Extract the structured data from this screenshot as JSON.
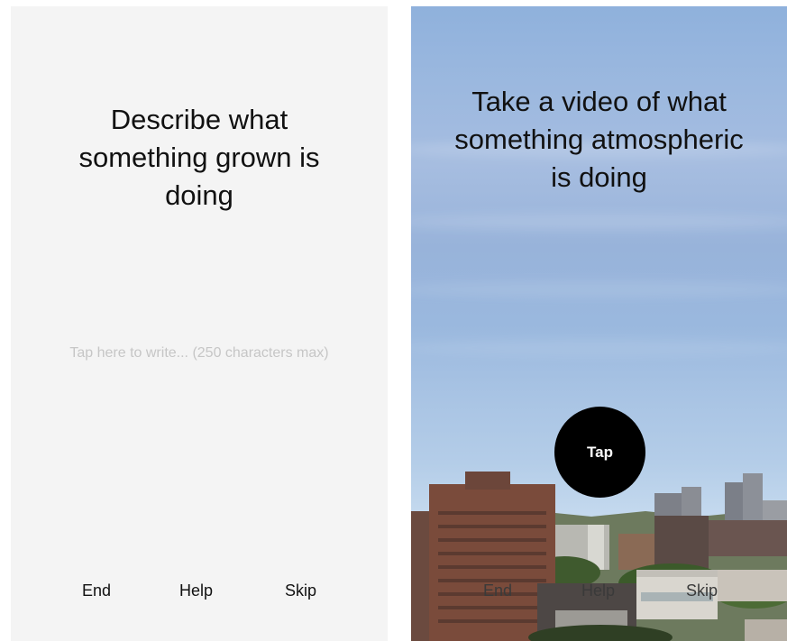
{
  "describe_screen": {
    "prompt": "Describe what something grown is doing",
    "input": {
      "placeholder": "Tap here to write... (250 characters max)",
      "value": ""
    },
    "nav": {
      "end": "End",
      "help": "Help",
      "skip": "Skip"
    }
  },
  "video_screen": {
    "prompt": "Take a video of what something atmospheric is doing",
    "record_button": "Tap",
    "nav": {
      "end": "End",
      "help": "Help",
      "skip": "Skip"
    }
  },
  "colors": {
    "panel_background": "#f4f4f4",
    "placeholder_text": "#c6c6c6",
    "record_button": "#000000",
    "sky_top": "#8fb1dc",
    "sky_bottom": "#d5e4f2"
  }
}
